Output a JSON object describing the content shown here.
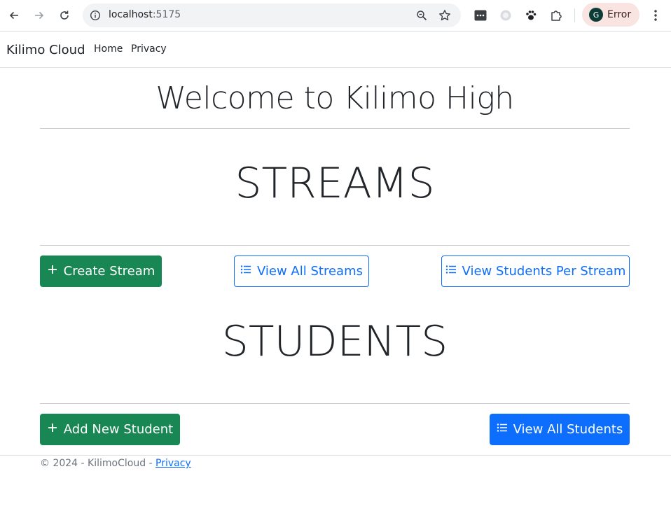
{
  "browser": {
    "url_host": "localhost",
    "url_port": ":5175",
    "profile_initial": "G",
    "profile_label": "Error",
    "icons": [
      "back-icon",
      "forward-icon",
      "reload-icon",
      "info-icon",
      "zoom-icon",
      "star-icon",
      "extension-dots-icon",
      "extension-circle-icon",
      "extension-paw-icon",
      "extensions-puzzle-icon",
      "menu-dots-icon"
    ]
  },
  "navbar": {
    "brand": "Kilimo Cloud",
    "links": [
      "Home",
      "Privacy"
    ]
  },
  "main": {
    "welcome": "Welcome to Kilimo High",
    "streams": {
      "title": "STREAMS",
      "create_label": "Create Stream",
      "view_all_label": "View All Streams",
      "per_stream_label": "View Students Per Stream"
    },
    "students": {
      "title": "STUDENTS",
      "add_label": "Add New Student",
      "view_all_label": "View All Students"
    }
  },
  "footer": {
    "text": "© 2024 - KilimoCloud - ",
    "privacy_link": "Privacy"
  },
  "colors": {
    "success": "#198754",
    "primary": "#0d6efd",
    "text": "#212529",
    "muted": "#6c757d"
  }
}
